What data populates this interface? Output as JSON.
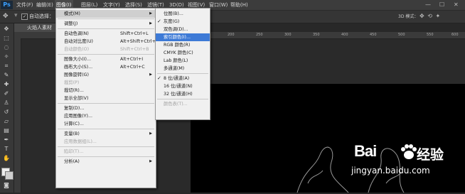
{
  "menubar": {
    "logo": "Ps",
    "items": [
      "文件(F)",
      "编辑(E)",
      "图像(I)",
      "图层(L)",
      "文字(Y)",
      "选择(S)",
      "滤镜(T)",
      "3D(D)",
      "视图(V)",
      "窗口(W)",
      "帮助(H)"
    ],
    "window_controls": [
      "—",
      "☐",
      "✕"
    ]
  },
  "options": {
    "auto_select_label": "自动选择：",
    "mode_label": "3D 模式："
  },
  "document": {
    "tab_title": "火焰人素材"
  },
  "ruler": {
    "marks": [
      "200",
      "250",
      "300",
      "350",
      "400",
      "450",
      "500",
      "550",
      "600"
    ]
  },
  "image_menu": {
    "items": [
      {
        "label": "模式(M)",
        "shortcut": "",
        "submenu": true,
        "state": "highlighted"
      },
      {
        "sep": true
      },
      {
        "label": "调整(J)",
        "shortcut": "",
        "submenu": true
      },
      {
        "sep": true
      },
      {
        "label": "自动色调(N)",
        "shortcut": "Shift+Ctrl+L"
      },
      {
        "label": "自动对比度(U)",
        "shortcut": "Alt+Shift+Ctrl+L"
      },
      {
        "label": "自动颜色(O)",
        "shortcut": "Shift+Ctrl+B",
        "disabled": true
      },
      {
        "sep": true
      },
      {
        "label": "图像大小(I)...",
        "shortcut": "Alt+Ctrl+I"
      },
      {
        "label": "画布大小(S)...",
        "shortcut": "Alt+Ctrl+C"
      },
      {
        "label": "图像旋转(G)",
        "shortcut": "",
        "submenu": true
      },
      {
        "label": "裁剪(P)",
        "shortcut": "",
        "disabled": true
      },
      {
        "label": "裁切(R)...",
        "shortcut": ""
      },
      {
        "label": "显示全部(V)",
        "shortcut": ""
      },
      {
        "sep": true
      },
      {
        "label": "复制(D)...",
        "shortcut": ""
      },
      {
        "label": "应用图像(Y)...",
        "shortcut": ""
      },
      {
        "label": "计算(C)...",
        "shortcut": ""
      },
      {
        "sep": true
      },
      {
        "label": "变量(B)",
        "shortcut": "",
        "submenu": true
      },
      {
        "label": "应用数据组(L)...",
        "shortcut": "",
        "disabled": true
      },
      {
        "sep": true
      },
      {
        "label": "陷印(T)...",
        "shortcut": "",
        "disabled": true
      },
      {
        "sep": true
      },
      {
        "label": "分析(A)",
        "shortcut": "",
        "submenu": true
      }
    ]
  },
  "mode_menu": {
    "items": [
      {
        "label": "位图(B)..."
      },
      {
        "label": "灰度(G)",
        "checked": true
      },
      {
        "label": "双色调(D)..."
      },
      {
        "label": "索引颜色(I)...",
        "selected": true
      },
      {
        "label": "RGB 颜色(R)"
      },
      {
        "label": "CMYK 颜色(C)"
      },
      {
        "label": "Lab 颜色(L)"
      },
      {
        "label": "多通道(M)"
      },
      {
        "sep": true
      },
      {
        "label": "8 位/通道(A)",
        "checked": true
      },
      {
        "label": "16 位/通道(N)"
      },
      {
        "label": "32 位/通道(H)"
      },
      {
        "sep": true
      },
      {
        "label": "颜色表(T)...",
        "disabled": true
      }
    ]
  },
  "watermark": {
    "brand": "Bai",
    "brand_cn": "经验",
    "url": "jingyan.baidu.com"
  },
  "colors": {
    "accent": "#3d7ad6",
    "menu_bg": "#f0f0f0",
    "app_bg": "#282828"
  }
}
